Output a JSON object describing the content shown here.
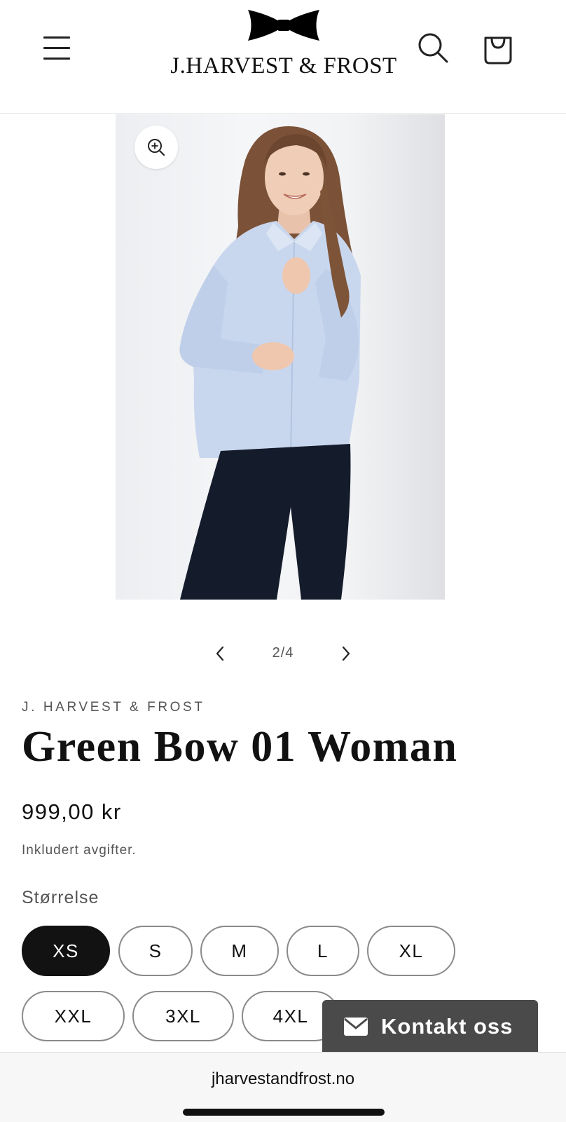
{
  "header": {
    "menu_icon": "hamburger-icon",
    "logo_text": "J.HARVEST & FROST",
    "logo_icon": "bow-tie-icon",
    "search_icon": "search-icon",
    "cart_icon": "cart-icon"
  },
  "gallery": {
    "zoom_icon": "zoom-in-icon",
    "counter": "2/4",
    "prev_icon": "chevron-left-icon",
    "next_icon": "chevron-right-icon"
  },
  "product": {
    "vendor": "J. HARVEST & FROST",
    "title": "Green Bow 01 Woman",
    "price": "999,00 kr",
    "tax_note": "Inkludert avgifter.",
    "size_label": "Størrelse",
    "sizes": [
      "XS",
      "S",
      "M",
      "L",
      "XL",
      "XXL",
      "3XL",
      "4XL"
    ],
    "selected_size": "XS"
  },
  "contact": {
    "icon": "envelope-icon",
    "label": "Kontakt oss"
  },
  "browser": {
    "url": "jharvestandfrost.no"
  },
  "colors": {
    "selected_pill": "#121212",
    "contact_bg": "#4a4a4a",
    "shirt": "#c9d7ee",
    "pants": "#141b2b"
  }
}
